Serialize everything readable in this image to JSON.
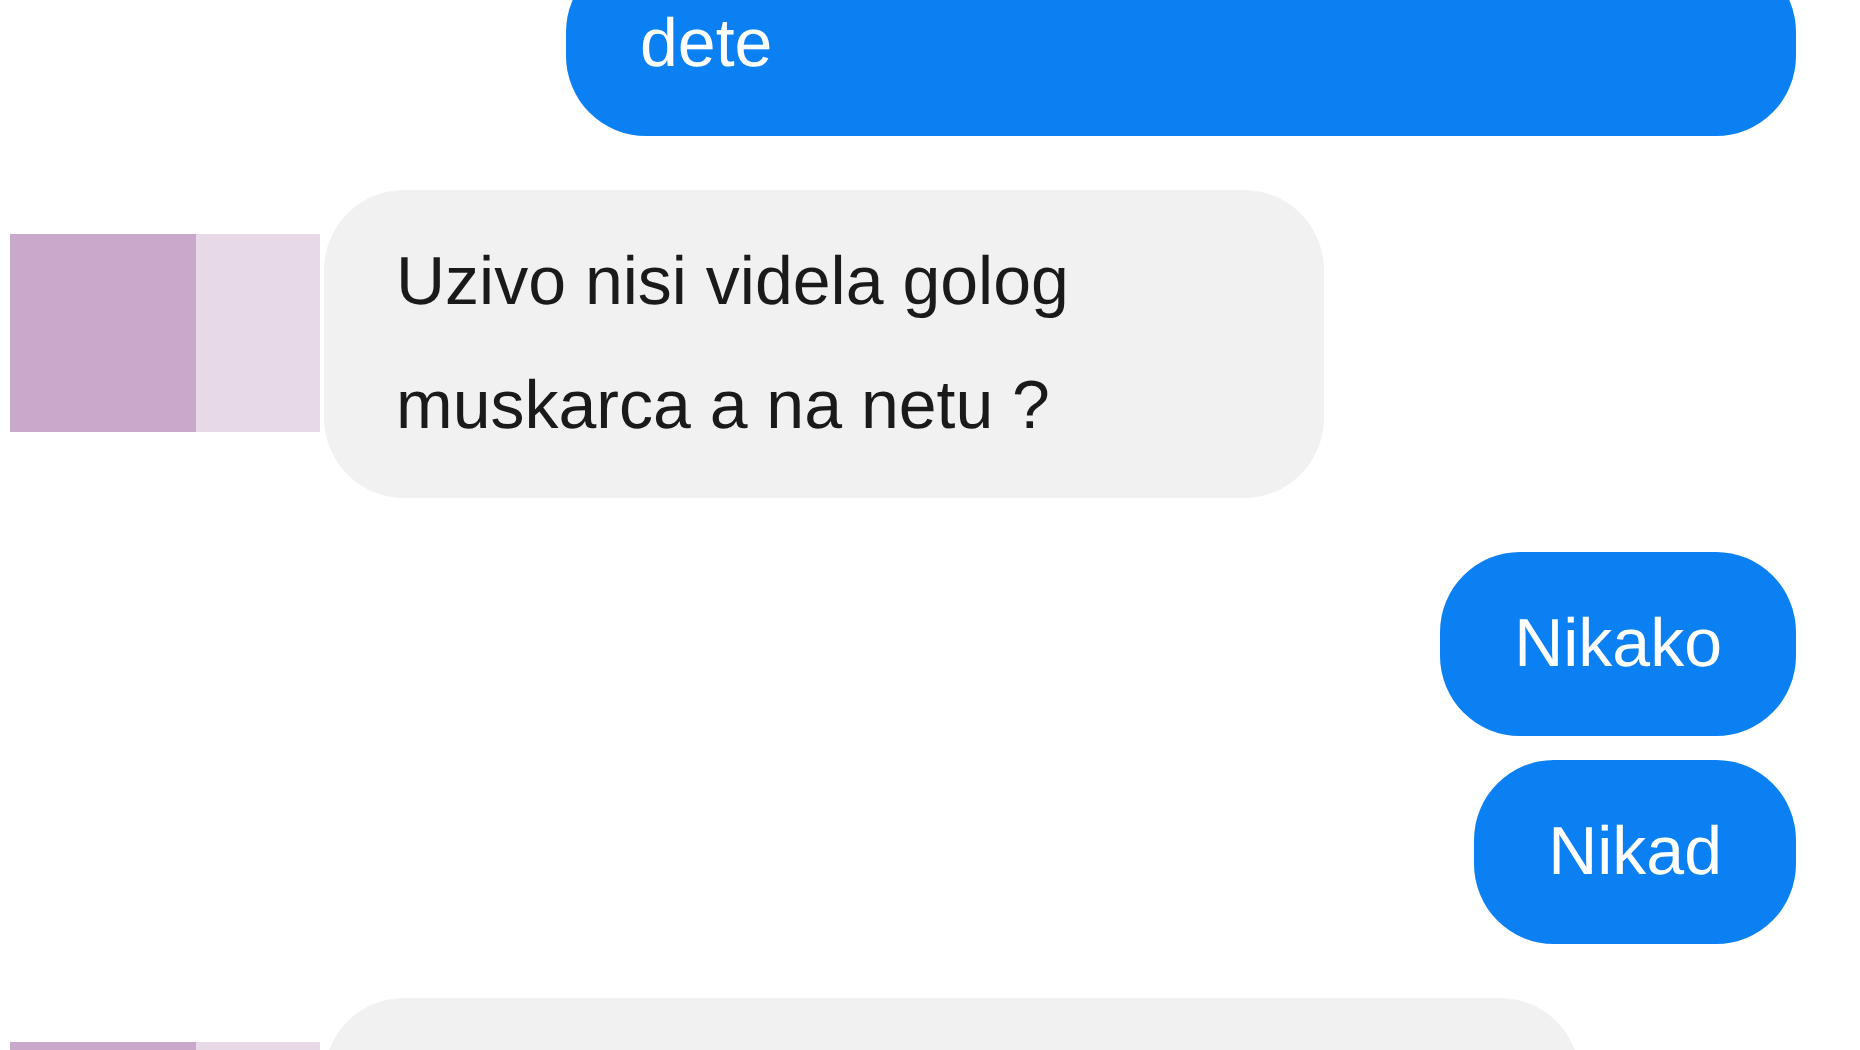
{
  "messages": [
    {
      "kind": "outgoing",
      "text": "dete"
    },
    {
      "kind": "incoming",
      "text": "Uzivo nisi videla golog muskarca a na netu ?"
    },
    {
      "kind": "outgoing",
      "text": "Nikako"
    },
    {
      "kind": "outgoing",
      "text": "Nikad"
    },
    {
      "kind": "incoming"
    }
  ]
}
